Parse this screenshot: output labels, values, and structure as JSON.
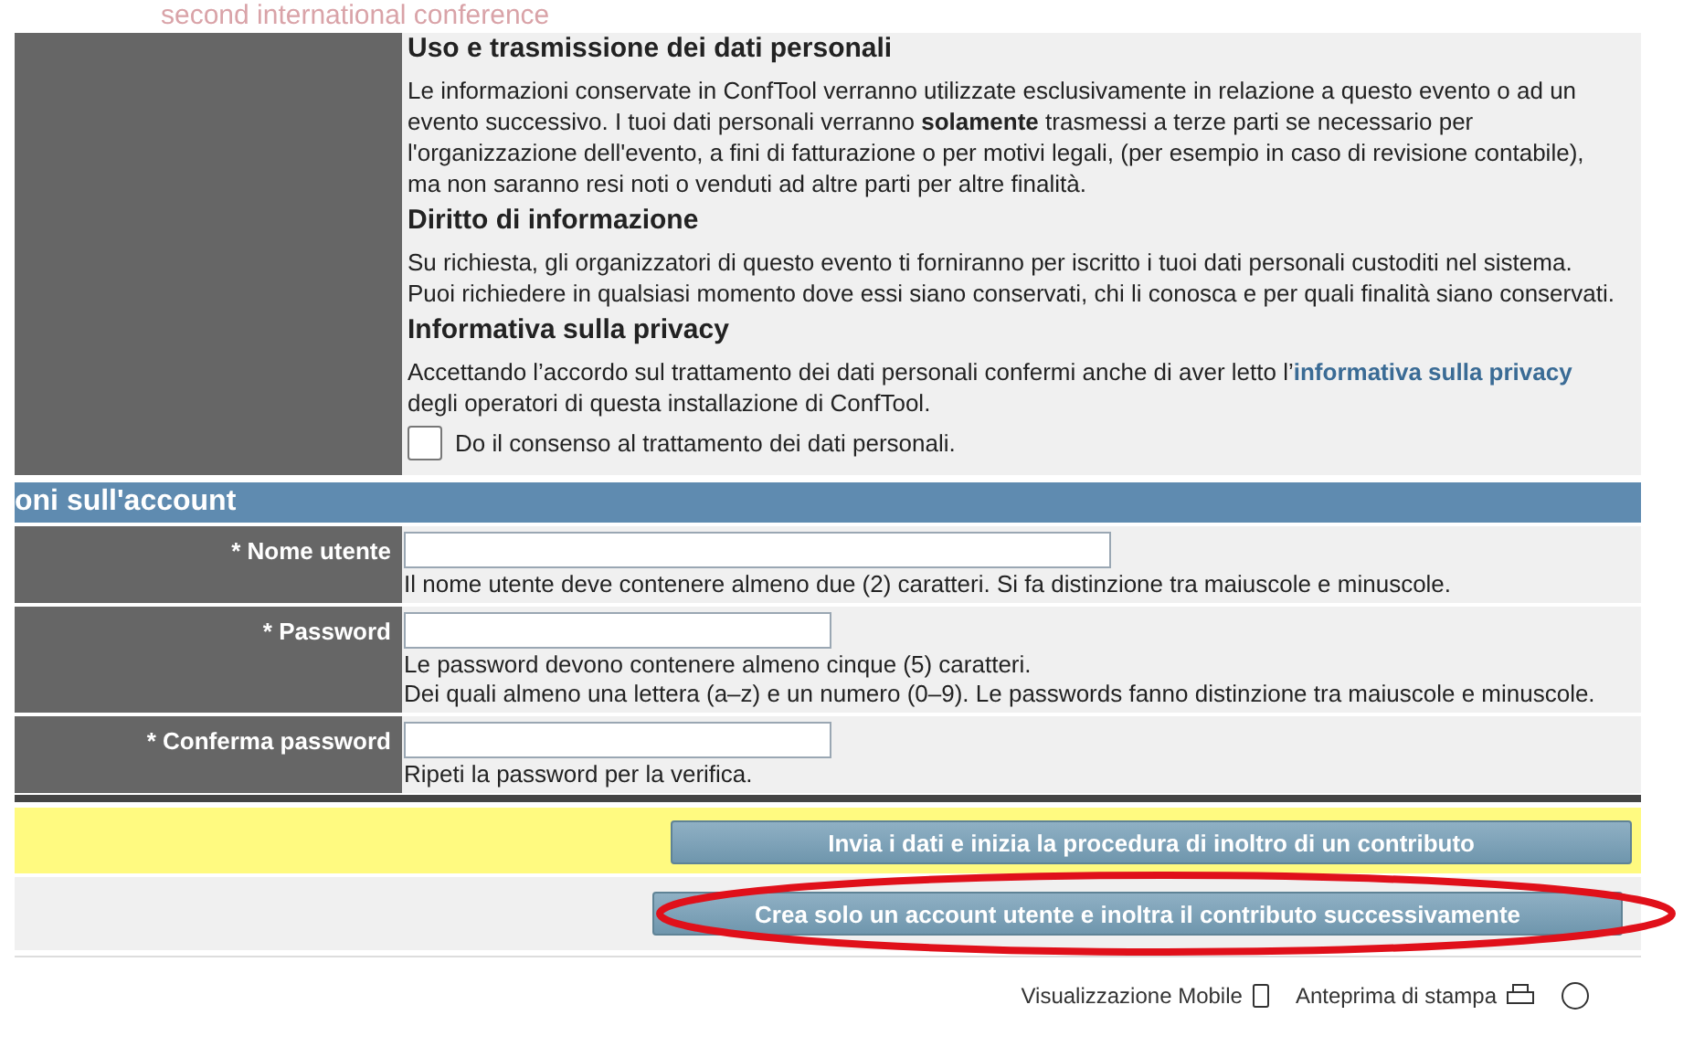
{
  "banner": {
    "title": "second international conference"
  },
  "privacy": {
    "sections": [
      {
        "heading": "Uso e trasmissione dei dati personali",
        "text": "Le informazioni conservate in ConfTool verranno utilizzate esclusivamente in relazione a questo evento o ad un evento successivo. I tuoi dati personali verranno **solamente** trasmessi a terze parti se necessario per l'organizzazione dell'evento, a fini di fatturazione o per motivi legali, (per esempio in caso di revisione contabile), ma non saranno resi noti o venduti ad altre parti per altre finalità."
      },
      {
        "heading": "Diritto di informazione",
        "text": "Su richiesta, gli organizzatori di questo evento ti forniranno per iscritto i tuoi dati personali custoditi nel sistema. Puoi richiedere in qualsiasi momento dove essi siano conservati, chi li conosca e per quali finalità siano conservati."
      },
      {
        "heading": "Informativa sulla privacy",
        "text_before": "Accettando l’accordo sul trattamento dei dati personali confermi anche di aver letto l’",
        "link": "informativa sulla privacy",
        "text_after": " degli operatori di questa installazione di ConfTool."
      }
    ],
    "consent": {
      "label": "Do il consenso al trattamento dei dati personali.",
      "checked": false
    }
  },
  "account": {
    "header": "oni sull'account",
    "fields": [
      {
        "label": "* Nome utente",
        "kind": "text",
        "hints": [
          "Il nome utente deve contenere almeno due (2) caratteri. Si fa distinzione tra maiuscole e minuscole."
        ]
      },
      {
        "label": "* Password",
        "kind": "password",
        "hints": [
          "Le password devono contenere almeno cinque (5) caratteri.",
          "Dei quali almeno una lettera (a–z) e un numero (0–9). Le passwords fanno distinzione tra maiuscole e minuscole."
        ]
      },
      {
        "label": "* Conferma password",
        "kind": "password",
        "hints": [
          "Ripeti la password per la verifica."
        ]
      }
    ]
  },
  "actions": [
    {
      "label": "Invia i dati e inizia la procedura di inoltro di un contributo",
      "highlighted": true,
      "circled": false
    },
    {
      "label": "Crea solo un account utente e inoltra il contributo successivamente",
      "highlighted": false,
      "circled": true
    }
  ],
  "footer": {
    "links": [
      {
        "label": "Visualizzazione Mobile",
        "kind": "mobile"
      },
      {
        "label": "Anteprima di stampa",
        "kind": "print"
      }
    ]
  }
}
